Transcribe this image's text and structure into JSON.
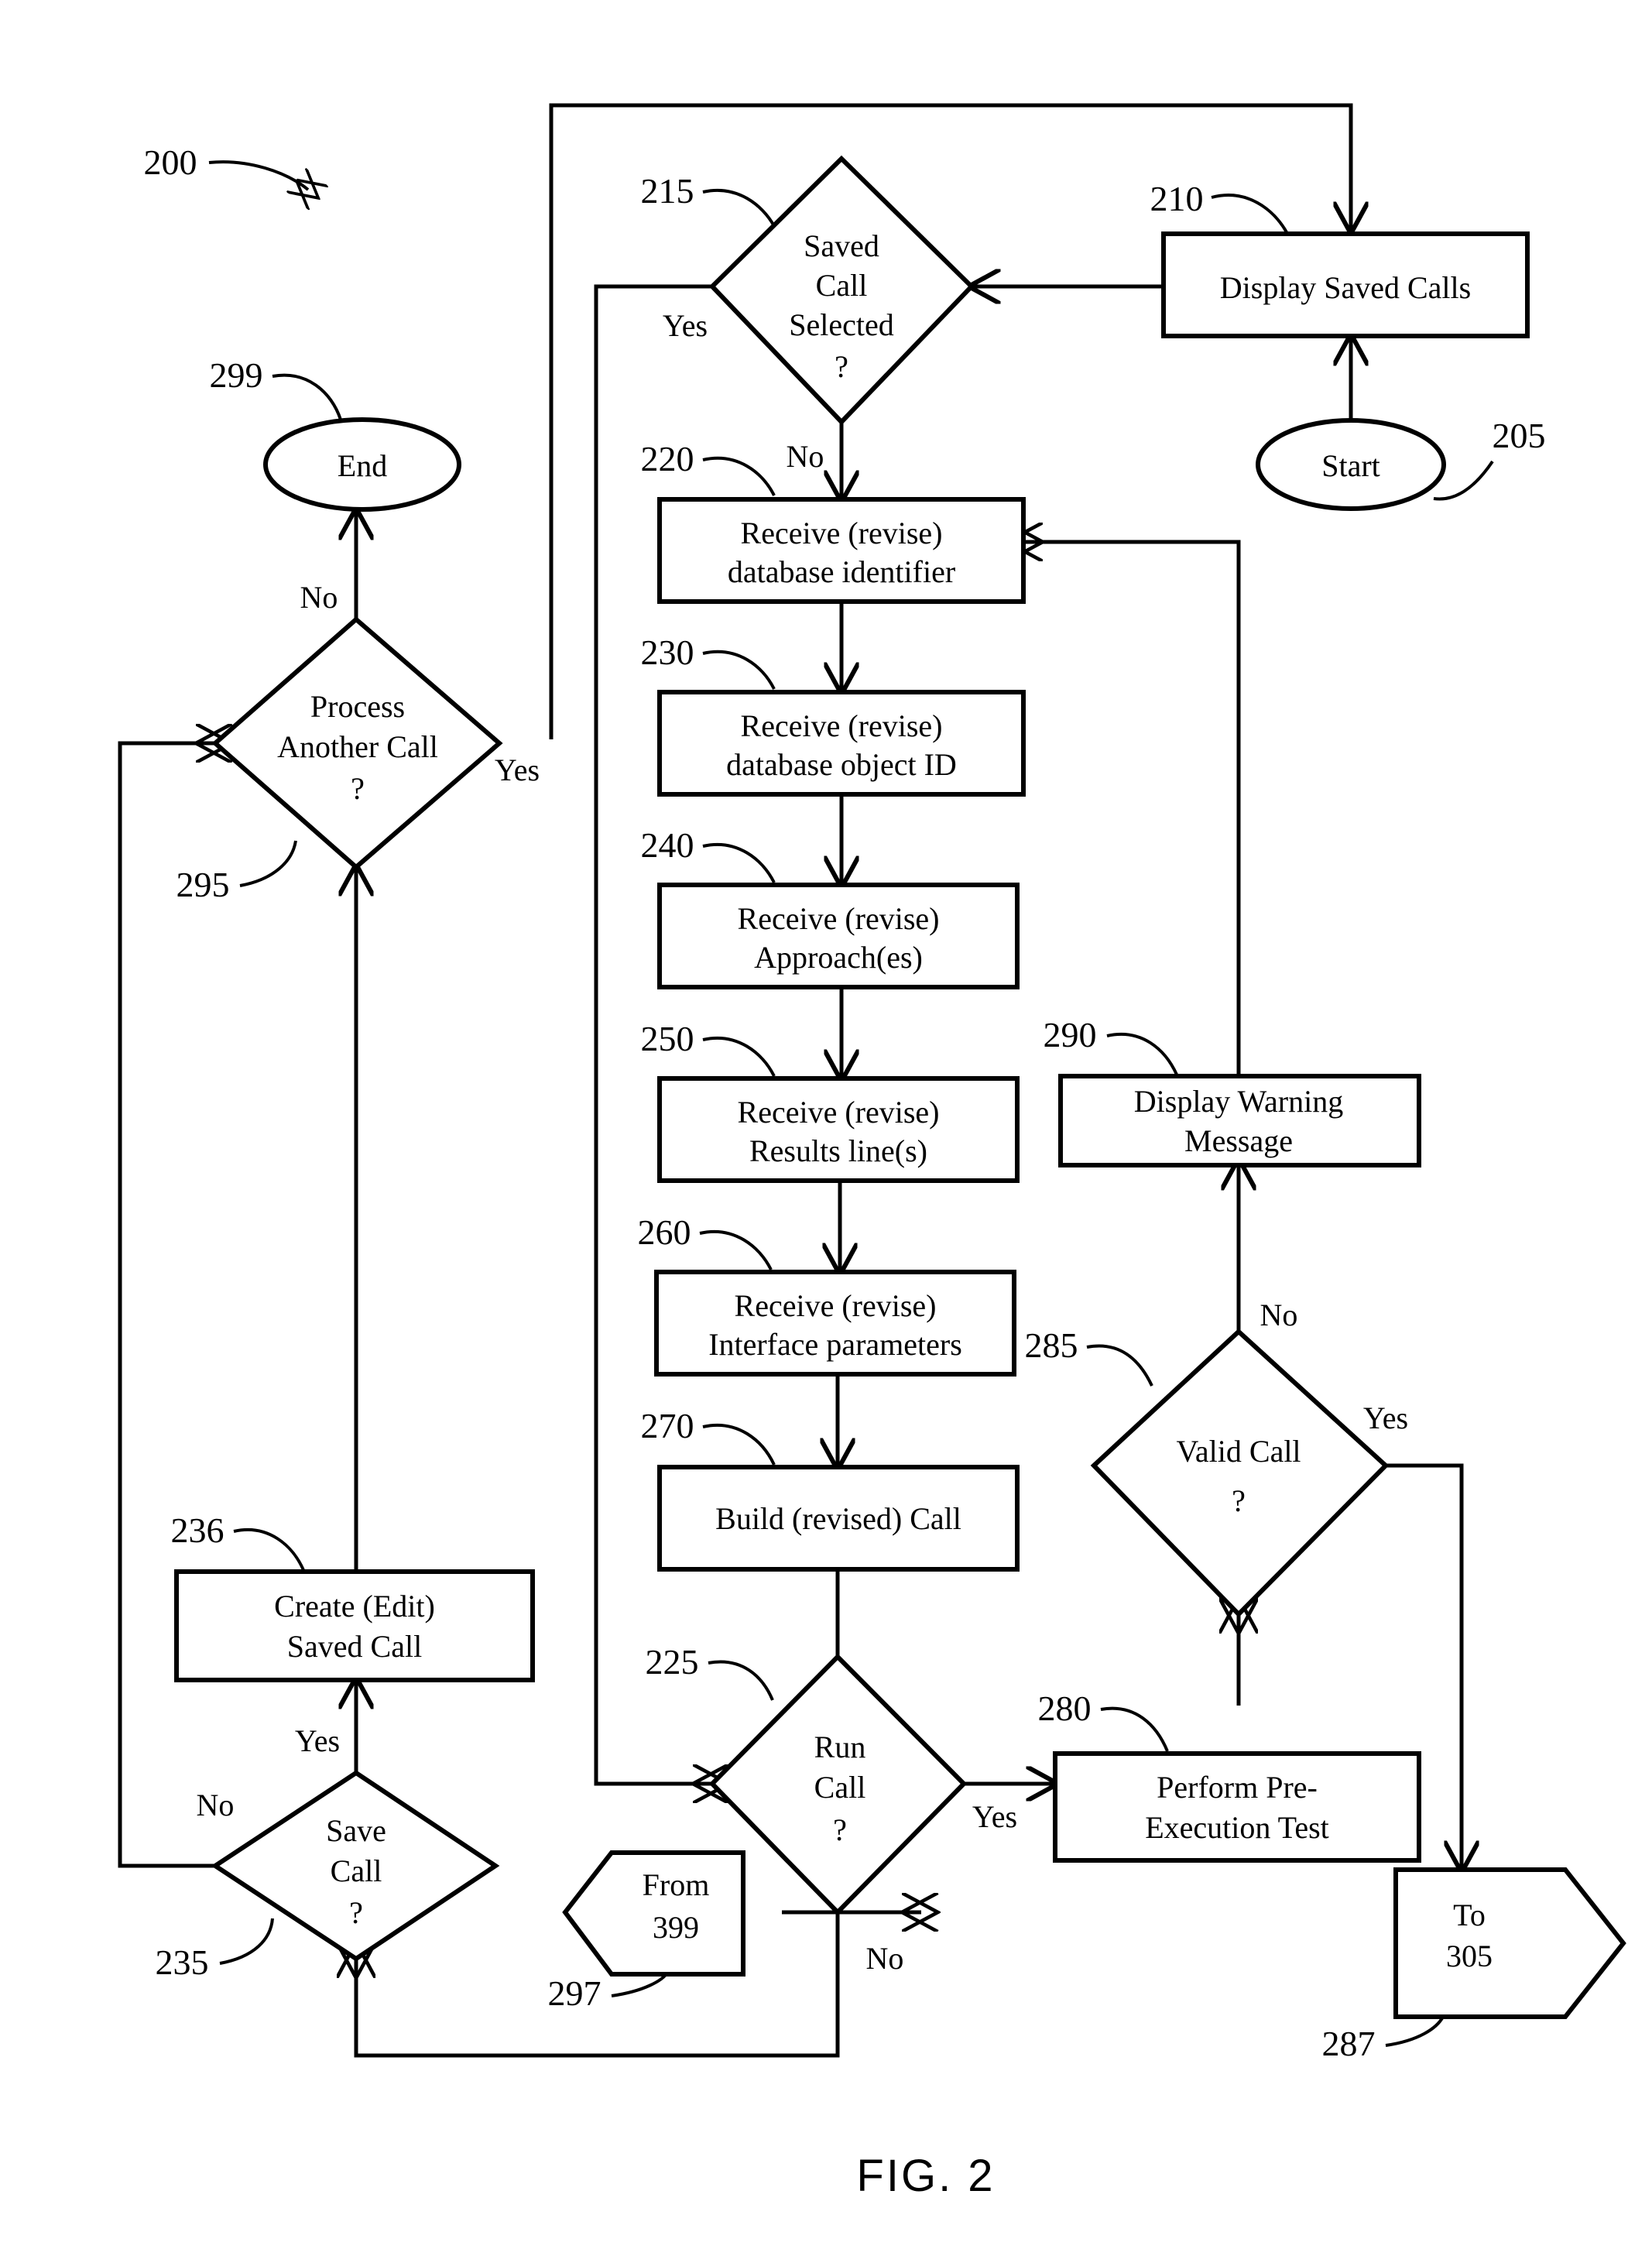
{
  "figure": {
    "caption": "FIG. 2",
    "diagram_ref": "200"
  },
  "chart_data": {
    "type": "diagram",
    "title": "FIG. 2",
    "diagram_kind": "flowchart",
    "nodes": [
      {
        "ref": "205",
        "shape": "terminator",
        "label": "Start"
      },
      {
        "ref": "210",
        "shape": "process",
        "label": "Display Saved Calls"
      },
      {
        "ref": "215",
        "shape": "decision",
        "label": "Saved Call Selected ?"
      },
      {
        "ref": "220",
        "shape": "process",
        "label": "Receive (revise) database identifier"
      },
      {
        "ref": "225",
        "shape": "decision",
        "label": "Run Call ?"
      },
      {
        "ref": "230",
        "shape": "process",
        "label": "Receive (revise) database object ID"
      },
      {
        "ref": "235",
        "shape": "decision",
        "label": "Save Call ?"
      },
      {
        "ref": "236",
        "shape": "process",
        "label": "Create (Edit) Saved Call"
      },
      {
        "ref": "240",
        "shape": "process",
        "label": "Receive (revise) Approach(es)"
      },
      {
        "ref": "250",
        "shape": "process",
        "label": "Receive (revise) Results line(s)"
      },
      {
        "ref": "260",
        "shape": "process",
        "label": "Receive (revise) Interface parameters"
      },
      {
        "ref": "270",
        "shape": "process",
        "label": "Build (revised) Call"
      },
      {
        "ref": "280",
        "shape": "process",
        "label": "Perform Pre-Execution Test"
      },
      {
        "ref": "285",
        "shape": "decision",
        "label": "Valid Call ?"
      },
      {
        "ref": "287",
        "shape": "connector",
        "label": "To 305"
      },
      {
        "ref": "290",
        "shape": "process",
        "label": "Display Warning Message"
      },
      {
        "ref": "295",
        "shape": "decision",
        "label": "Process Another Call ?"
      },
      {
        "ref": "297",
        "shape": "connector",
        "label": "From 399"
      },
      {
        "ref": "299",
        "shape": "terminator",
        "label": "End"
      }
    ],
    "edges": [
      {
        "from": "205",
        "to": "210",
        "label": ""
      },
      {
        "from": "210",
        "to": "215",
        "label": ""
      },
      {
        "from": "215",
        "to": "225",
        "label": "Yes"
      },
      {
        "from": "215",
        "to": "220",
        "label": "No"
      },
      {
        "from": "220",
        "to": "230",
        "label": ""
      },
      {
        "from": "230",
        "to": "240",
        "label": ""
      },
      {
        "from": "240",
        "to": "250",
        "label": ""
      },
      {
        "from": "250",
        "to": "260",
        "label": ""
      },
      {
        "from": "260",
        "to": "270",
        "label": ""
      },
      {
        "from": "270",
        "to": "225",
        "label": ""
      },
      {
        "from": "225",
        "to": "280",
        "label": "Yes"
      },
      {
        "from": "225",
        "to": "235",
        "label": "No"
      },
      {
        "from": "280",
        "to": "285",
        "label": ""
      },
      {
        "from": "285",
        "to": "287",
        "label": "Yes"
      },
      {
        "from": "285",
        "to": "290",
        "label": "No"
      },
      {
        "from": "290",
        "to": "220",
        "label": ""
      },
      {
        "from": "297",
        "to": "225",
        "label": ""
      },
      {
        "from": "235",
        "to": "236",
        "label": "Yes"
      },
      {
        "from": "235",
        "to": "295",
        "label": "No"
      },
      {
        "from": "236",
        "to": "295",
        "label": ""
      },
      {
        "from": "295",
        "to": "299",
        "label": "No"
      },
      {
        "from": "295",
        "to": "215",
        "label": "Yes"
      }
    ]
  },
  "nodes": {
    "start": {
      "ref": "205",
      "label": "Start"
    },
    "display_saved_calls": {
      "ref": "210",
      "label": "Display Saved Calls"
    },
    "saved_call_selected": {
      "ref": "215",
      "line1": "Saved",
      "line2": "Call",
      "line3": "Selected",
      "line4": "?"
    },
    "receive_db_identifier": {
      "ref": "220",
      "line1": "Receive (revise)",
      "line2": "database identifier"
    },
    "receive_db_object_id": {
      "ref": "230",
      "line1": "Receive (revise)",
      "line2": "database object ID"
    },
    "receive_approaches": {
      "ref": "240",
      "line1": "Receive (revise)",
      "line2": "Approach(es)"
    },
    "receive_results_lines": {
      "ref": "250",
      "line1": "Receive (revise)",
      "line2": "Results line(s)"
    },
    "receive_interface_parameters": {
      "ref": "260",
      "line1": "Receive (revise)",
      "line2": "Interface parameters"
    },
    "build_revised_call": {
      "ref": "270",
      "label": "Build (revised) Call"
    },
    "run_call": {
      "ref": "225",
      "line1": "Run",
      "line2": "Call",
      "line3": "?"
    },
    "perform_pre_execution_test": {
      "ref": "280",
      "line1": "Perform Pre-",
      "line2": "Execution Test"
    },
    "valid_call": {
      "ref": "285",
      "line1": "Valid Call",
      "line2": "?"
    },
    "to_305": {
      "ref": "287",
      "line1": "To",
      "line2": "305"
    },
    "display_warning_message": {
      "ref": "290",
      "line1": "Display Warning",
      "line2": "Message"
    },
    "save_call": {
      "ref": "235",
      "line1": "Save",
      "line2": "Call",
      "line3": "?"
    },
    "from_399": {
      "ref": "297",
      "line1": "From",
      "line2": "399"
    },
    "create_edit_saved_call": {
      "ref": "236",
      "line1": "Create (Edit)",
      "line2": "Saved Call"
    },
    "process_another_call": {
      "ref": "295",
      "line1": "Process",
      "line2": "Another Call",
      "line3": "?"
    },
    "end": {
      "ref": "299",
      "label": "End"
    }
  },
  "branch_labels": {
    "saved_call_selected_yes": "Yes",
    "saved_call_selected_no": "No",
    "run_call_yes": "Yes",
    "run_call_no": "No",
    "valid_call_yes": "Yes",
    "valid_call_no": "No",
    "save_call_yes": "Yes",
    "save_call_no": "No",
    "process_another_call_yes": "Yes",
    "process_another_call_no": "No"
  }
}
